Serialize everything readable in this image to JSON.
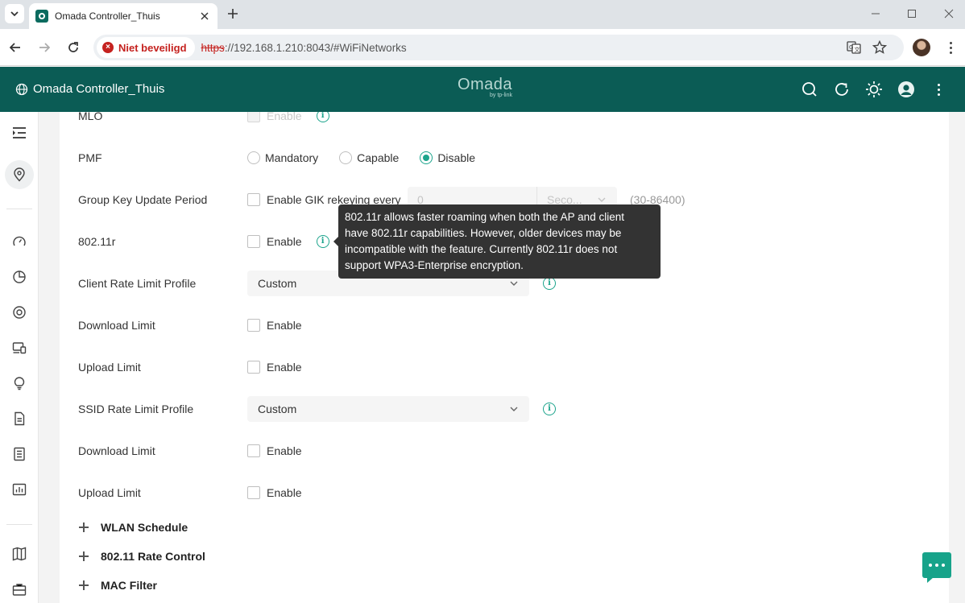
{
  "browser": {
    "tab_title": "Omada Controller_Thuis",
    "security_label": "Niet beveiligd",
    "url_scheme": "https",
    "url_rest": "://192.168.1.210:8043/#WiFiNetworks"
  },
  "header": {
    "site_name": "Omada Controller_Thuis",
    "brand_name": "Omada",
    "brand_sub": "by tp-link"
  },
  "form": {
    "mlo": {
      "label": "MLO",
      "option": "Enable"
    },
    "pmf": {
      "label": "PMF",
      "options": [
        "Mandatory",
        "Capable",
        "Disable"
      ],
      "selected": "Disable"
    },
    "gik": {
      "label": "Group Key Update Period",
      "option": "Enable GIK rekeying every",
      "value": "0",
      "unit": "Seco...",
      "range": "(30-86400)"
    },
    "r11": {
      "label": "802.11r",
      "option": "Enable"
    },
    "client_rate": {
      "label": "Client Rate Limit Profile",
      "value": "Custom"
    },
    "client_download": {
      "label": "Download Limit",
      "option": "Enable"
    },
    "client_upload": {
      "label": "Upload Limit",
      "option": "Enable"
    },
    "ssid_rate": {
      "label": "SSID Rate Limit Profile",
      "value": "Custom"
    },
    "ssid_download": {
      "label": "Download Limit",
      "option": "Enable"
    },
    "ssid_upload": {
      "label": "Upload Limit",
      "option": "Enable"
    }
  },
  "sections": [
    "WLAN Schedule",
    "802.11 Rate Control",
    "MAC Filter"
  ],
  "tooltip": {
    "line1": "802.11r allows faster roaming when both the AP and client",
    "line2": "have 802.11r capabilities. However, older devices may be",
    "line3": "incompatible with the feature. Currently 802.11r does not",
    "line4": "support WPA3-Enterprise encryption."
  },
  "colors": {
    "header_bg": "#0b5c55",
    "accent": "#1ca48c",
    "insecure": "#c5221f"
  }
}
